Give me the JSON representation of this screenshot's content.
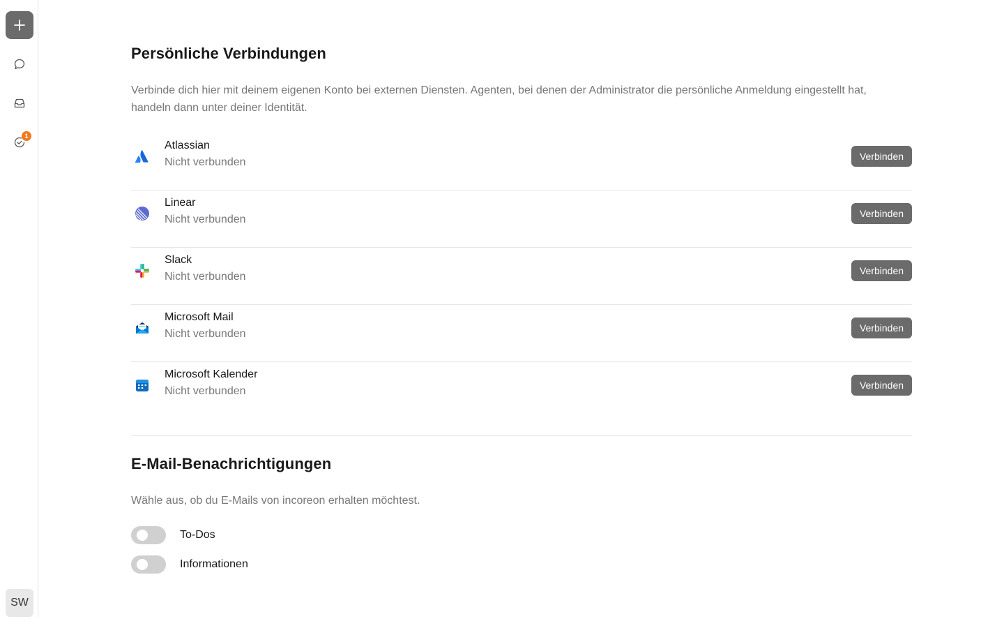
{
  "sidebar": {
    "new_icon": "plus-icon",
    "items": [
      {
        "icon": "chat-bubble-icon"
      },
      {
        "icon": "inbox-icon"
      },
      {
        "icon": "todo-check-icon",
        "badge": "1"
      }
    ],
    "avatar_initials": "SW"
  },
  "connections": {
    "title": "Persönliche Verbindungen",
    "description": "Verbinde dich hier mit deinem eigenen Konto bei externen Diensten. Agenten, bei denen der Administrator die persönliche Anmeldung eingestellt hat, handeln dann unter deiner Identität.",
    "items": [
      {
        "name": "Atlassian",
        "status": "Nicht verbunden",
        "button": "Verbinden",
        "icon": "atlassian-logo-icon"
      },
      {
        "name": "Linear",
        "status": "Nicht verbunden",
        "button": "Verbinden",
        "icon": "linear-logo-icon"
      },
      {
        "name": "Slack",
        "status": "Nicht verbunden",
        "button": "Verbinden",
        "icon": "slack-logo-icon"
      },
      {
        "name": "Microsoft Mail",
        "status": "Nicht verbunden",
        "button": "Verbinden",
        "icon": "microsoft-mail-logo-icon"
      },
      {
        "name": "Microsoft Kalender",
        "status": "Nicht verbunden",
        "button": "Verbinden",
        "icon": "microsoft-calendar-logo-icon"
      }
    ]
  },
  "email_notifications": {
    "title": "E-Mail-Benachrichtigungen",
    "description": "Wähle aus, ob du E-Mails von incoreon erhalten möchtest.",
    "toggles": [
      {
        "label": "To-Dos",
        "enabled": false
      },
      {
        "label": "Informationen",
        "enabled": false
      }
    ]
  },
  "colors": {
    "button_bg": "#6b6b6b",
    "badge": "#f07b1d",
    "toggle_off": "#d0d0d0"
  }
}
